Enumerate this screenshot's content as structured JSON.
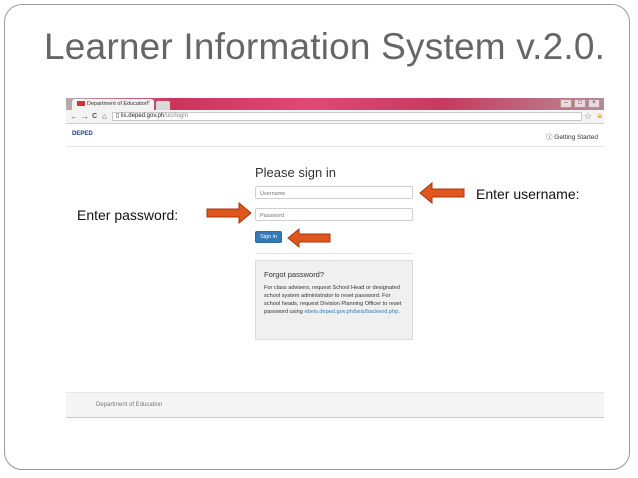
{
  "slide": {
    "title": "Learner Information System v.2.0."
  },
  "browser": {
    "tab_title": "Department of Education",
    "tab_close": "×",
    "nav": {
      "back": "←",
      "forward": "→",
      "reload": "C",
      "home": "⌂"
    },
    "url_host": "lis.deped.gov.ph",
    "url_path": "/uis/login",
    "window_controls": [
      "–",
      "□",
      "×"
    ]
  },
  "site": {
    "logo_text": "DEPED",
    "getting_started": "Getting Started",
    "signin_title": "Please sign in",
    "username_placeholder": "Username",
    "password_placeholder": "Password",
    "signin_button": "Sign in",
    "forgot": {
      "title": "Forgot password?",
      "text": "For class advisers, request School Head or designated school system administrator to reset password. For school heads, request Division Planning Officer to reset password using",
      "link": "ebeis.deped.gov.ph/beis/backend.php",
      "after_link": "."
    },
    "footer_text": "Department of Education"
  },
  "annotations": {
    "username_callout": "Enter username:",
    "password_callout": "Enter password:",
    "arrow_color": "#d24a1c"
  }
}
